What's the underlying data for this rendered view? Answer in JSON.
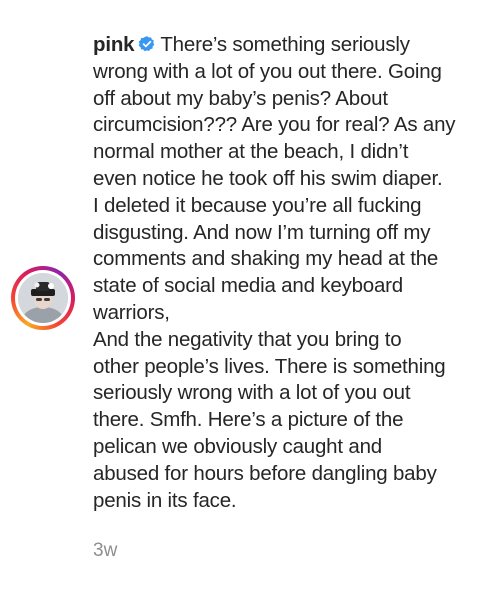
{
  "post": {
    "username": "pink",
    "caption_lines": [
      "There’s something seriously",
      "wrong with a lot of you out there. Going",
      "off about my baby’s penis? About",
      "circumcision??? Are you for real? As any",
      "normal mother at the beach, I didn’t",
      "even notice he took off his swim diaper.",
      "I deleted it because you’re all fucking",
      "disgusting. And now I’m turning off my",
      "comments and shaking my head at the",
      "state of social media and keyboard",
      "warriors,",
      "And the negativity that you bring to",
      "other people’s lives. There is something",
      "seriously wrong with a lot of you out",
      "there. Smfh. Here’s a picture of the",
      "pelican we obviously caught and",
      "abused for hours before dangling baby",
      "penis in its face."
    ],
    "timestamp": "3w",
    "verified_icon": "verified-badge-icon",
    "colors": {
      "text": "#262626",
      "muted": "#8e8e8e",
      "verified": "#3897f0"
    }
  }
}
